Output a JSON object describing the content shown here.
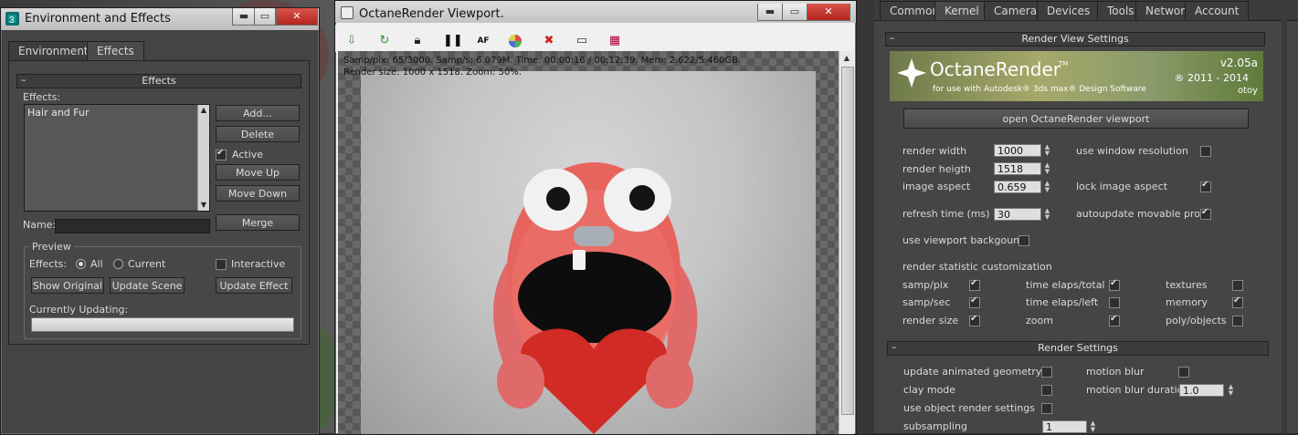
{
  "env_window": {
    "title": "Environment and Effects",
    "tabs": [
      "Environment",
      "Effects"
    ],
    "effects_rollout": {
      "header": "Effects",
      "effects_label": "Effects:",
      "list_items": [
        "Hair and Fur"
      ],
      "buttons": {
        "add": "Add...",
        "delete": "Delete",
        "move_up": "Move Up",
        "move_down": "Move Down",
        "merge": "Merge"
      },
      "active_label": "Active",
      "active_checked": true,
      "name_label": "Name:",
      "name_value": ""
    },
    "preview": {
      "title": "Preview",
      "effects_label": "Effects:",
      "radio_all": "All",
      "radio_current": "Current",
      "selected": "All",
      "interactive_label": "Interactive",
      "interactive_checked": false,
      "show_original": "Show Original",
      "update_scene": "Update Scene",
      "update_effect": "Update Effect",
      "currently_updating_label": "Currently Updating:",
      "progress": 0
    }
  },
  "viewport_window": {
    "title": "OctaneRender Viewport.",
    "toolbar_icons": [
      "export-icon",
      "refresh-icon",
      "lock-icon",
      "pause-icon",
      "af-icon",
      "color-wheel-icon",
      "stop-icon",
      "monitor-icon",
      "film-icon"
    ],
    "af_label": "AF",
    "stats_line1": "Samp/pix: 65/3000.   Samp/s: 6.079M.   Time: 00:00:16 / 00:12:39.   Mem: 2.622/5.460GB.",
    "stats_line2": "Render size: 1000 x 1518.  Zoom: 50%."
  },
  "octane_panel": {
    "tabs": [
      "Common",
      "Kernel",
      "Camera",
      "Devices",
      "Tools",
      "Network",
      "Account"
    ],
    "active_tab": "Kernel",
    "render_view_settings": {
      "header": "Render View Settings",
      "banner": {
        "brand": "OctaneRender",
        "tm": "TM",
        "tagline": "for use with Autodesk® 3ds max® Design Software",
        "version": "v2.05a",
        "years": "® 2011 - 2014",
        "vendor": "otoy"
      },
      "open_viewport_button": "open OctaneRender viewport",
      "render_width_label": "render width",
      "render_width": "1000",
      "render_height_label": "render heigth",
      "render_height": "1518",
      "image_aspect_label": "image aspect",
      "image_aspect": "0.659",
      "use_window_resolution_label": "use window resolution",
      "use_window_resolution": false,
      "lock_image_aspect_label": "lock image aspect",
      "lock_image_aspect": true,
      "refresh_time_label": "refresh time (ms)",
      "refresh_time": "30",
      "autoupdate_label": "autoupdate movable proxy",
      "autoupdate": true,
      "use_viewport_background_label": "use viewport backgound",
      "use_viewport_background": false,
      "statistic_title": "render statistic customization",
      "stats": [
        {
          "label": "samp/pix",
          "checked": true
        },
        {
          "label": "time elaps/total",
          "checked": true
        },
        {
          "label": "textures",
          "checked": false
        },
        {
          "label": "samp/sec",
          "checked": true
        },
        {
          "label": "time elaps/left",
          "checked": false
        },
        {
          "label": "memory",
          "checked": true
        },
        {
          "label": "render size",
          "checked": true
        },
        {
          "label": "zoom",
          "checked": true
        },
        {
          "label": "poly/objects",
          "checked": false
        }
      ]
    },
    "render_settings": {
      "header": "Render Settings",
      "update_animated_geometry_label": "update animated geometry",
      "update_animated_geometry": false,
      "motion_blur_label": "motion blur",
      "motion_blur": false,
      "clay_mode_label": "clay mode",
      "clay_mode": false,
      "motion_blur_duration_label": "motion blur duration",
      "motion_blur_duration": "1.0",
      "use_object_render_settings_label": "use object render settings",
      "use_object_render_settings": false,
      "subsampling_label": "subsampling",
      "subsampling": "1"
    }
  }
}
